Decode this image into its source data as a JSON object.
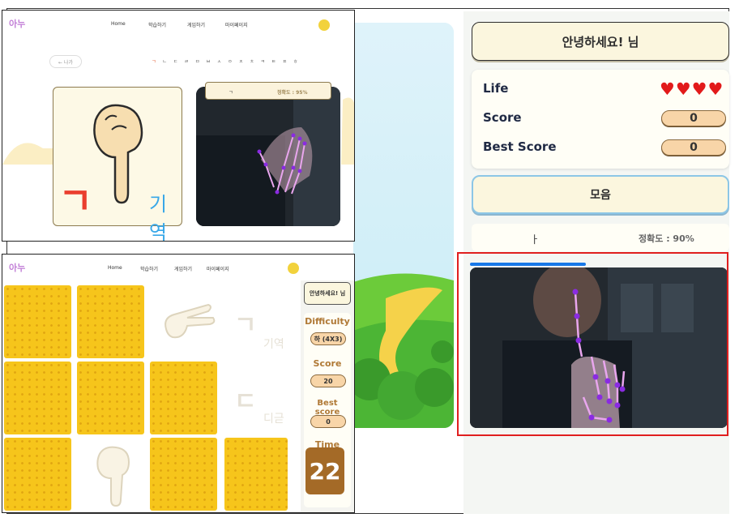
{
  "game_panel": {
    "greeting": "안녕하세요! 님",
    "life_label": "Life",
    "hearts": [
      "heart-icon",
      "heart-icon",
      "heart-icon",
      "heart-icon"
    ],
    "score_label": "Score",
    "score_value": "0",
    "best_label": "Best Score",
    "best_value": "0",
    "mode_label": "모음",
    "result_char": "ㅏ",
    "result_accuracy": "정확도 : 90%",
    "progress": 0.45
  },
  "learn_screen": {
    "logo": "아누",
    "nav": [
      "Home",
      "학습하기",
      "게임하기",
      "마이페이지"
    ],
    "back_label": "← 나가",
    "consonants": [
      "ㄱ",
      "ㄴ",
      "ㄷ",
      "ㄹ",
      "ㅁ",
      "ㅂ",
      "ㅅ",
      "ㅇ",
      "ㅈ",
      "ㅊ",
      "ㅋ",
      "ㅌ",
      "ㅍ",
      "ㅎ"
    ],
    "big_letter": "ㄱ",
    "letter_name": "기역",
    "accuracy_char": "ㄱ",
    "accuracy_text": "정확도 : 95%"
  },
  "memory_screen": {
    "logo": "아누",
    "nav": [
      "Home",
      "학습하기",
      "게임하기",
      "마이페이지"
    ],
    "greeting": "안녕하세요! 님",
    "difficulty_label": "Difficulty",
    "difficulty_value": "하 (4X3)",
    "score_label": "Score",
    "score_value": "20",
    "best_label": "Best score",
    "best_value": "0",
    "time_label": "Time",
    "time_value": "22",
    "ghost_cards": [
      {
        "letter": "ㄱ",
        "name": "기역"
      },
      {
        "letter": "ㄷ",
        "name": "디귿"
      }
    ]
  }
}
